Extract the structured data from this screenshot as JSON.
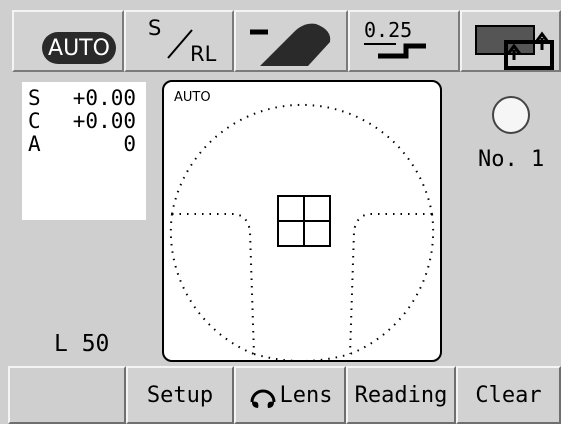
{
  "toolbar": {
    "mode_label": "AUTO",
    "sub_s": "S",
    "sub_rl": "RL",
    "step_label": "0.25"
  },
  "readings": {
    "rows": [
      {
        "label": "S",
        "value": "+0.00"
      },
      {
        "label": "C",
        "value": "+0.00"
      },
      {
        "label": "A",
        "value": "0"
      }
    ],
    "l_value": "L 50"
  },
  "target": {
    "mode_label": "AUTO"
  },
  "indicator": {
    "number_label": "No. 1"
  },
  "bottom": {
    "setup_label": "Setup",
    "lens_label": "Lens",
    "reading_label": "Reading",
    "clear_label": "Clear"
  },
  "colors": {
    "background": "#cfcfcf",
    "panel": "#ffffff",
    "pill": "#2a2a2a"
  },
  "icons": {
    "lens_shape": "lens-profile-icon",
    "step": "step-increment-icon",
    "window": "window-stack-icon",
    "lens_button": "lens-face-icon"
  }
}
